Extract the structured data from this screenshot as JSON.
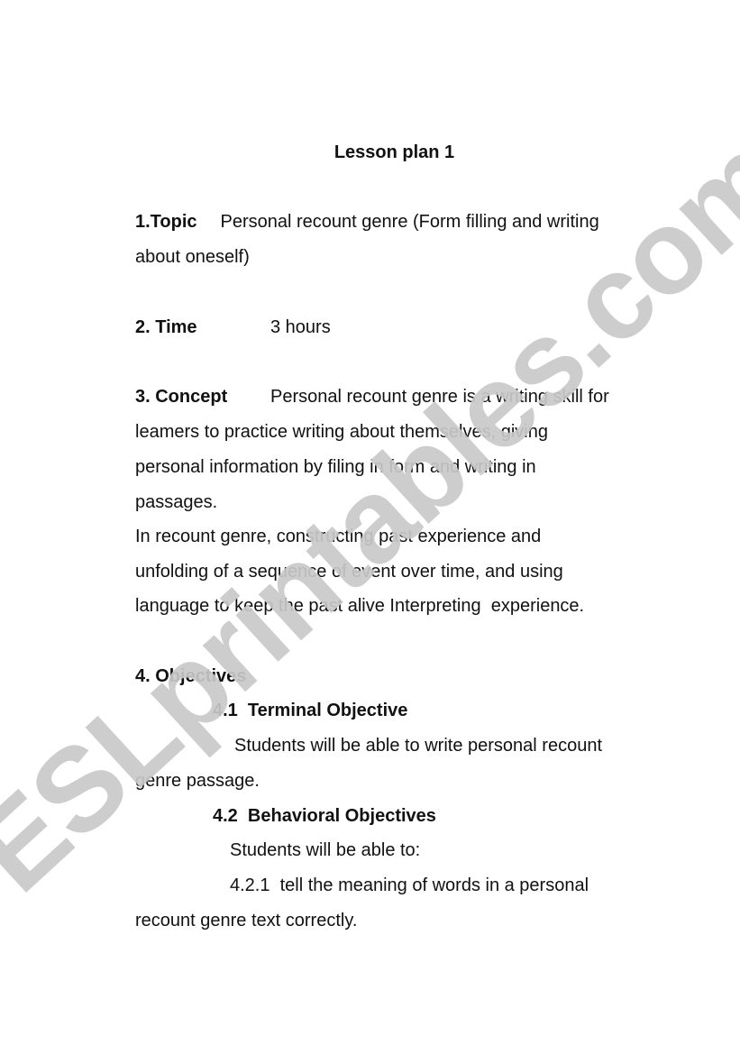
{
  "document": {
    "title": "Lesson plan 1",
    "sections": {
      "topic": {
        "label": "1.Topic",
        "text_line1": "Personal recount genre (Form filling and writing",
        "text_line2": "about oneself)"
      },
      "time": {
        "label": "2. Time",
        "value": "3 hours"
      },
      "concept": {
        "label": "3. Concept",
        "lines": [
          "Personal recount genre is a writing skill for",
          "leamers to practice writing about themselves, giving",
          "personal information by filing in form and writing in",
          "passages.",
          "In recount genre, constructing past experience and",
          "unfolding of a sequence of event over time, and using",
          "language to keep the past alive Interpreting  experience."
        ]
      },
      "objectives": {
        "label": "4. Objectives",
        "terminal": {
          "label": "4.1  Terminal Objective",
          "text_line1": "Students will be able to write personal recount",
          "text_line2": "genre passage."
        },
        "behavioral": {
          "label": "4.2  Behavioral Objectives",
          "intro": "Students will be able to:",
          "items": [
            {
              "line1": "4.2.1  tell the meaning of words in a personal",
              "line2": "recount genre text correctly."
            }
          ]
        }
      }
    }
  },
  "watermark": {
    "text": "ESLprintables.com",
    "color": "#c9c9c9"
  }
}
